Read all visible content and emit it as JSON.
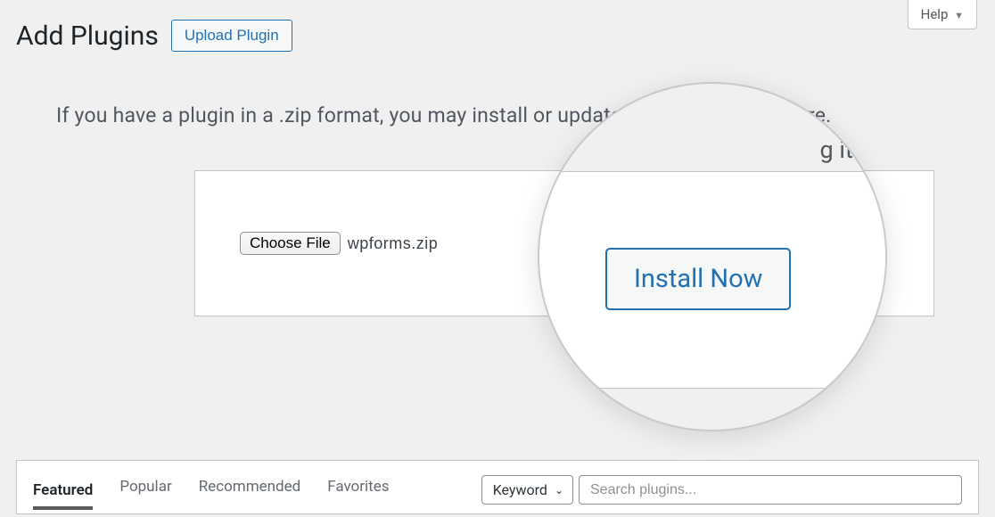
{
  "help": {
    "label": "Help"
  },
  "header": {
    "title": "Add Plugins",
    "upload_button": "Upload Plugin"
  },
  "upload": {
    "instruction": "If you have a plugin in a .zip format, you may install or update it by uploading it here.",
    "instruction_visible": "If you have a plugin in a .zip format, you may install it by uploading it here.",
    "choose_file_label": "Choose File",
    "filename": "wpforms.zip",
    "install_now_label": "Install Now"
  },
  "magnifier": {
    "partial_text": "g it here.",
    "button_label": "Install Now"
  },
  "tabs": [
    {
      "label": "Featured",
      "active": true
    },
    {
      "label": "Popular",
      "active": false
    },
    {
      "label": "Recommended",
      "active": false
    },
    {
      "label": "Favorites",
      "active": false
    }
  ],
  "search": {
    "filter_label": "Keyword",
    "placeholder": "Search plugins..."
  }
}
